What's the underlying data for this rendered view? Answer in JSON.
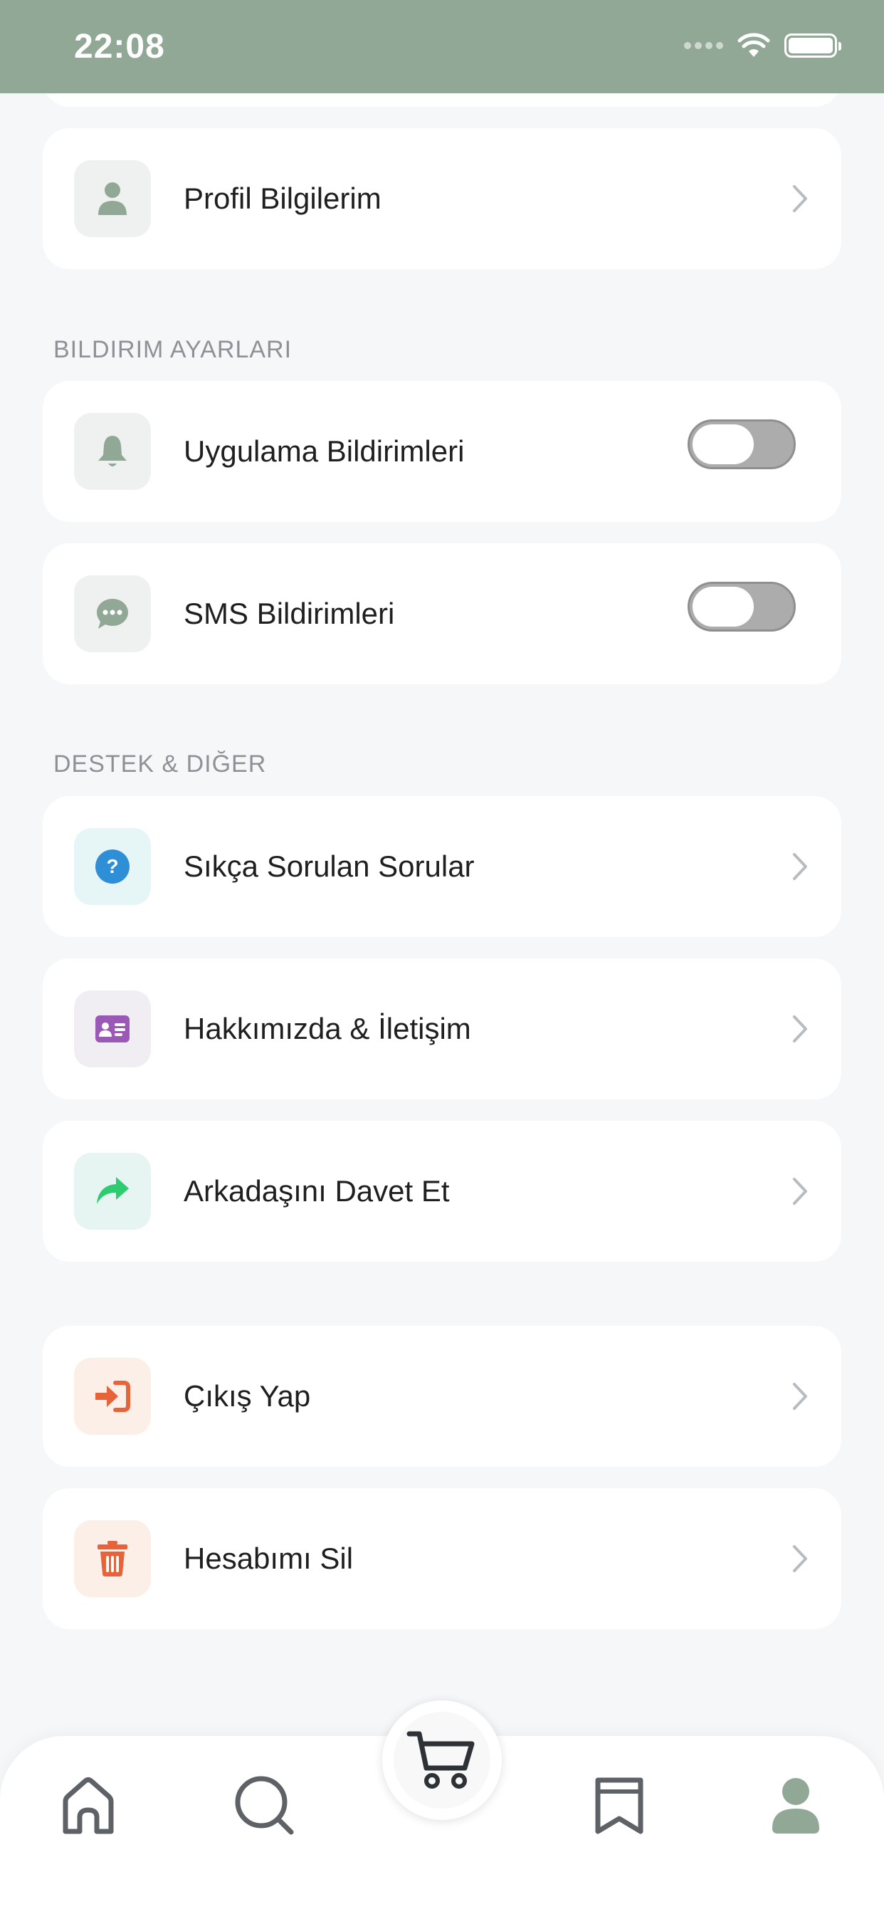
{
  "status_bar": {
    "time": "22:08"
  },
  "profile_item": {
    "label": "Profil Bilgilerim"
  },
  "notification_section": {
    "header": "BILDIRIM AYARLARI",
    "items": [
      {
        "label": "Uygulama Bildirimleri",
        "enabled": false
      },
      {
        "label": "SMS Bildirimleri",
        "enabled": false
      }
    ]
  },
  "support_section": {
    "header": "DESTEK & DIĞER",
    "items": [
      {
        "label": "Sıkça Sorulan Sorular"
      },
      {
        "label": "Hakkımızda & İletişim"
      },
      {
        "label": "Arkadaşını Davet Et"
      }
    ]
  },
  "account_section": {
    "items": [
      {
        "label": "Çıkış Yap"
      },
      {
        "label": "Hesabımı Sil"
      }
    ]
  },
  "bottom_nav": {
    "items": [
      {
        "icon": "home-icon"
      },
      {
        "icon": "search-icon"
      },
      {
        "icon": "cart-icon"
      },
      {
        "icon": "bookmark-icon"
      },
      {
        "icon": "profile-icon",
        "active": true
      }
    ]
  },
  "colors": {
    "status_bar": "#91a896",
    "accent_green": "#91a896",
    "faq_blue": "#2f8fd6",
    "about_purple": "#9b59b6",
    "invite_green": "#2ecc71",
    "danger_orange": "#e8623a",
    "background": "#f6f7f9"
  }
}
